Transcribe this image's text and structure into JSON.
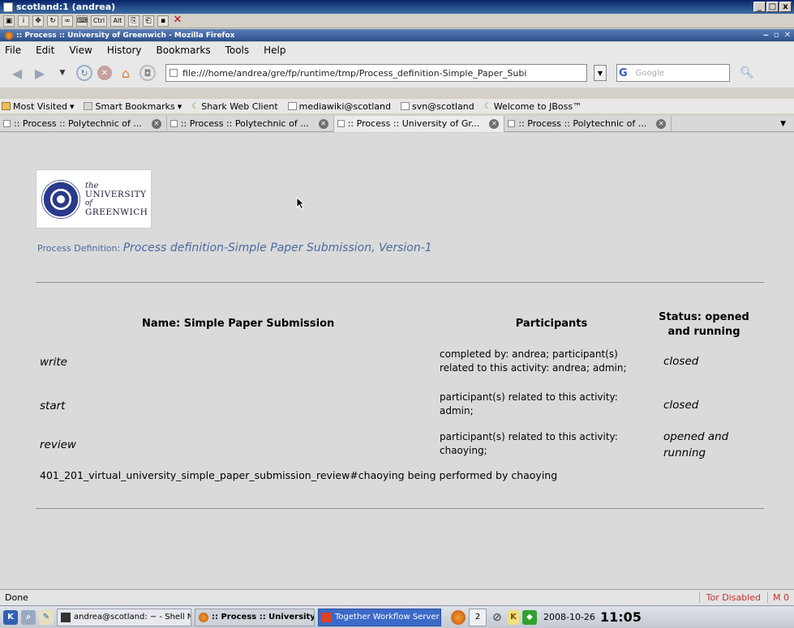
{
  "vnc": {
    "title": "scotland:1 (andrea)",
    "toolbar_buttons": [
      "Ctrl",
      "Alt"
    ]
  },
  "firefox": {
    "title": ":: Process :: University of Greenwich - Mozilla Firefox"
  },
  "menu": [
    "File",
    "Edit",
    "View",
    "History",
    "Bookmarks",
    "Tools",
    "Help"
  ],
  "nav": {
    "url": "file:///home/andrea/gre/fp/runtime/tmp/Process_definition-Simple_Paper_Subi",
    "search_placeholder": "Google",
    "search_engine": "G"
  },
  "bookmarks": [
    {
      "label": "Most Visited",
      "icon": "folder-icon",
      "dropdown": true
    },
    {
      "label": "Smart Bookmarks",
      "icon": "folder-icon",
      "dropdown": true
    },
    {
      "label": "Shark Web Client",
      "icon": "swirl-icon"
    },
    {
      "label": "mediawiki@scotland",
      "icon": "page-icon"
    },
    {
      "label": "svn@scotland",
      "icon": "page-icon"
    },
    {
      "label": "Welcome to JBoss™",
      "icon": "swirl-icon"
    }
  ],
  "tabs": [
    {
      "label": ":: Process :: Polytechnic of ...",
      "active": false
    },
    {
      "label": ":: Process :: Polytechnic of ...",
      "active": false
    },
    {
      "label": ":: Process :: University of Gr...",
      "active": true
    },
    {
      "label": ":: Process :: Polytechnic of ...",
      "active": false
    }
  ],
  "logo": {
    "the": "the",
    "university": "UNIVERSITY",
    "of": "of",
    "greenwich": "GREENWICH"
  },
  "process": {
    "label": "Process Definition:",
    "value": "Process definition-Simple Paper Submission, Version-1"
  },
  "table": {
    "headers": {
      "name": "Name: Simple Paper Submission",
      "participants": "Participants",
      "status_line1": "Status: opened",
      "status_line2": "and running"
    },
    "rows": [
      {
        "activity": "write",
        "participants_line1": "completed by: andrea; participant(s)",
        "participants_line2": "related to this activity: andrea; admin;",
        "status_line1": "closed",
        "status_line2": ""
      },
      {
        "activity": "start",
        "participants_line1": "participant(s) related to this activity:",
        "participants_line2": "admin;",
        "status_line1": "closed",
        "status_line2": ""
      },
      {
        "activity": "review",
        "participants_line1": "participant(s) related to this activity:",
        "participants_line2": "chaoying;",
        "status_line1": "opened and",
        "status_line2": "running"
      }
    ],
    "note": "401_201_virtual_university_simple_paper_submission_review#chaoying being performed by chaoying"
  },
  "status": {
    "text": "Done",
    "tor": "Tor Disabled",
    "gmail": "M 0"
  },
  "taskbar": {
    "tasks": [
      {
        "label": "andrea@scotland: ~ - Shell No.",
        "active": false
      },
      {
        "label": ":: Process :: University of Gr",
        "active": true
      },
      {
        "label": "Together Workflow Server Adr",
        "active": false
      }
    ],
    "desktop": "2",
    "date": "2008-10-26",
    "time": "11:05"
  }
}
